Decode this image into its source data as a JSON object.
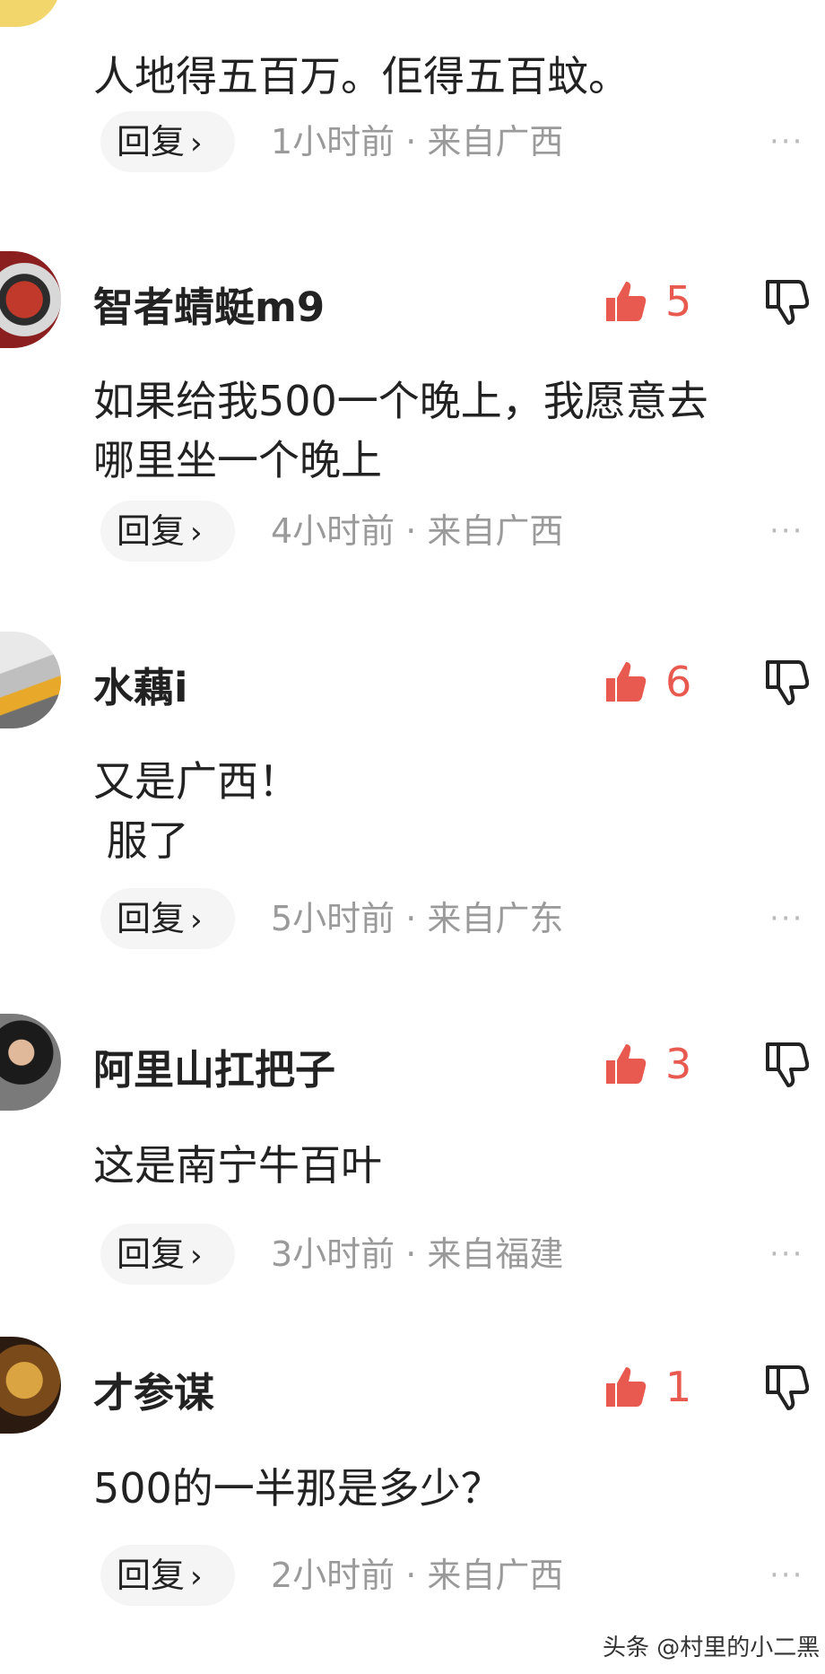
{
  "top_partial": {
    "body": "人地得五百万。佢得五百蚊。",
    "reply_label": "回复",
    "meta": "1小时前 · 来自广西"
  },
  "comments": [
    {
      "username": "智者蜻蜓m9",
      "likes": "5",
      "body": "如果给我500一个晚上，我愿意去\n哪里坐一个晚上",
      "reply_label": "回复",
      "meta": "4小时前 · 来自广西"
    },
    {
      "username": "水藕i",
      "likes": "6",
      "body": "又是广西！\n 服了",
      "reply_label": "回复",
      "meta": "5小时前 · 来自广东"
    },
    {
      "username": "阿里山扛把子",
      "likes": "3",
      "body": "这是南宁牛百叶",
      "reply_label": "回复",
      "meta": "3小时前 · 来自福建"
    },
    {
      "username": "才参谋",
      "likes": "1",
      "body": "500的一半那是多少？",
      "reply_label": "回复",
      "meta": "2小时前 · 来自广西"
    }
  ],
  "more_label": "···",
  "watermark": "头条 @村里的小二黑",
  "colors": {
    "like": "#e8594f",
    "meta": "#9a9a9a",
    "reply_bg": "#f5f5f5"
  },
  "icons": {
    "like": "thumbs-up-icon",
    "dislike": "thumbs-down-icon",
    "more": "more-dots-icon",
    "chevron": "chevron-right-icon"
  }
}
